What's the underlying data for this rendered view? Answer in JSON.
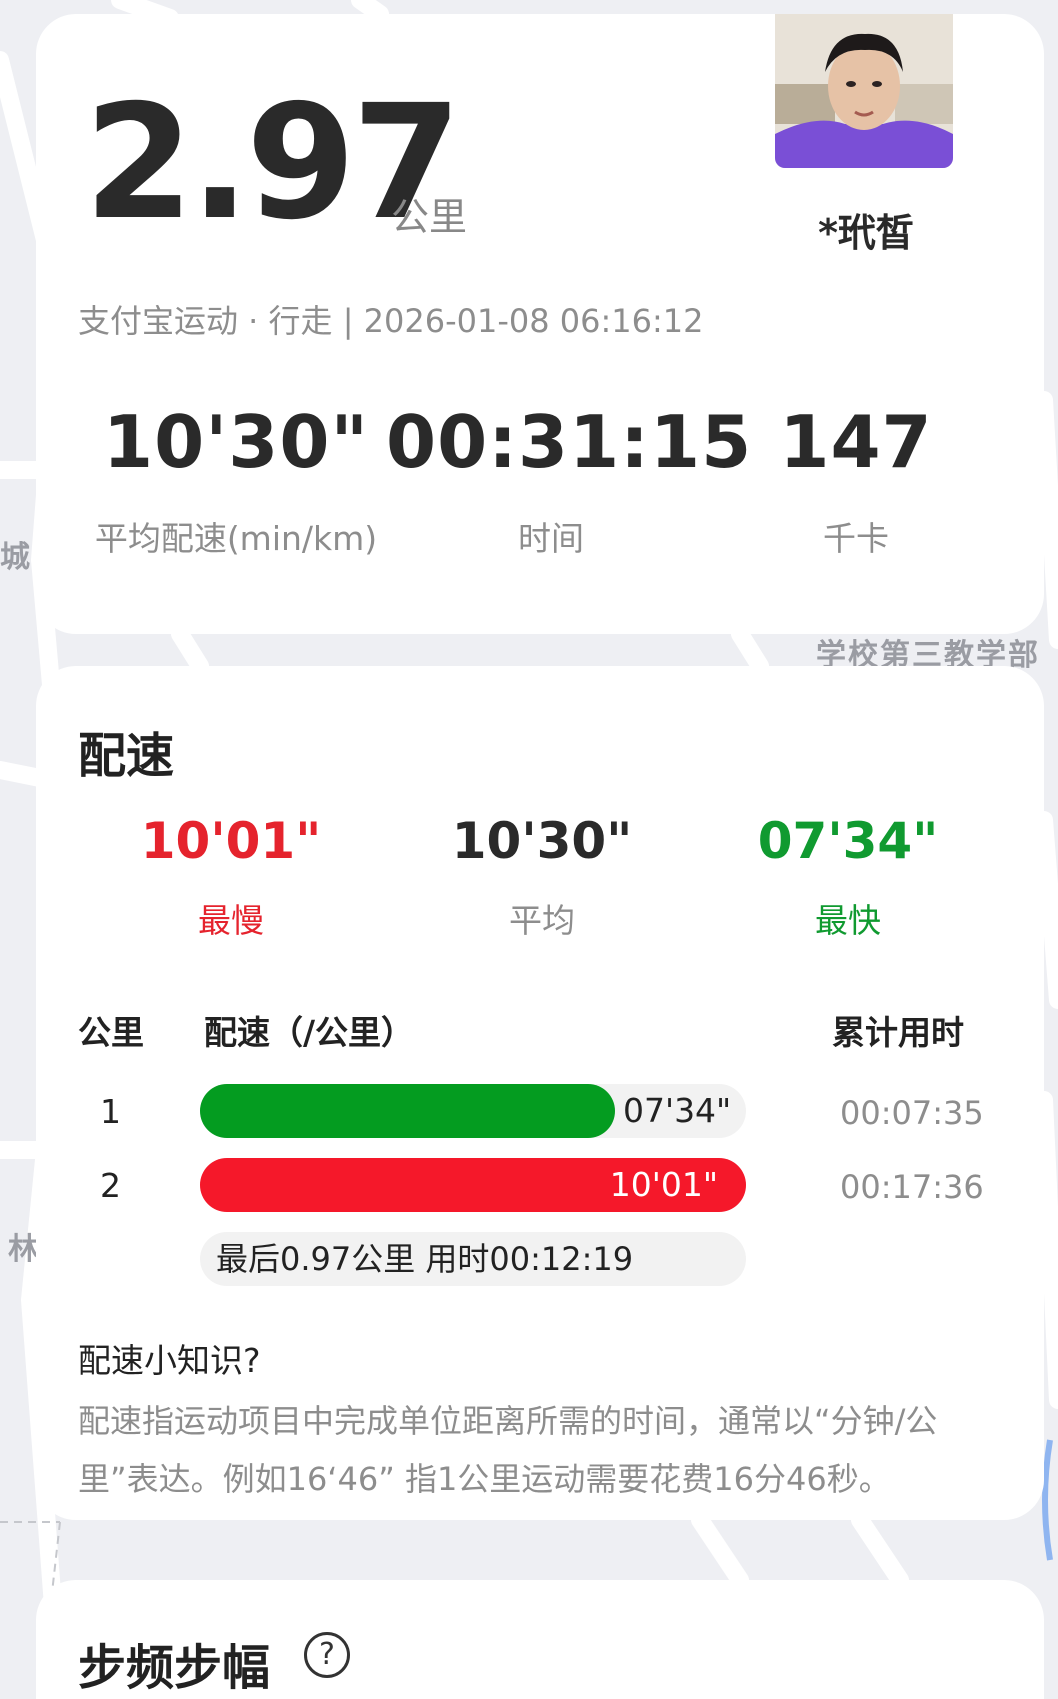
{
  "map": {
    "labels": [
      "城",
      "学校第三教学部",
      "林"
    ]
  },
  "summary": {
    "distance": "2.97",
    "distance_unit": "公里",
    "username": "*玳皙",
    "avatar_alt": "avatar",
    "meta": "支付宝运动 · 行走 | 2026-01-08 06:16:12",
    "stats": [
      {
        "value": "10'30\"",
        "label": "平均配速(min/km)"
      },
      {
        "value": "00:31:15",
        "label": "时间"
      },
      {
        "value": "147",
        "label": "千卡"
      }
    ]
  },
  "pace": {
    "title": "配速",
    "slowest": {
      "value": "10'01\"",
      "label": "最慢"
    },
    "average": {
      "value": "10'30\"",
      "label": "平均"
    },
    "fastest": {
      "value": "07'34\"",
      "label": "最快"
    },
    "table_headers": {
      "km": "公里",
      "pace": "配速（/公里）",
      "cumulative": "累计用时"
    },
    "splits": [
      {
        "km": "1",
        "pace": "07'34\"",
        "fill": 0.76,
        "color": "#049c20",
        "cumulative": "00:07:35"
      },
      {
        "km": "2",
        "pace": "10'01\"",
        "fill": 1.0,
        "color": "#f5182a",
        "cumulative": "00:17:36"
      }
    ],
    "last_segment": "最后0.97公里 用时00:12:19",
    "tip_title": "配速小知识?",
    "tip_body": "配速指运动项目中完成单位距离所需的时间，通常以“分钟/公里”表达。例如16‘46” 指1公里运动需要花费16分46秒。"
  },
  "cadence": {
    "title": "步频步幅",
    "help_symbol": "?"
  }
}
